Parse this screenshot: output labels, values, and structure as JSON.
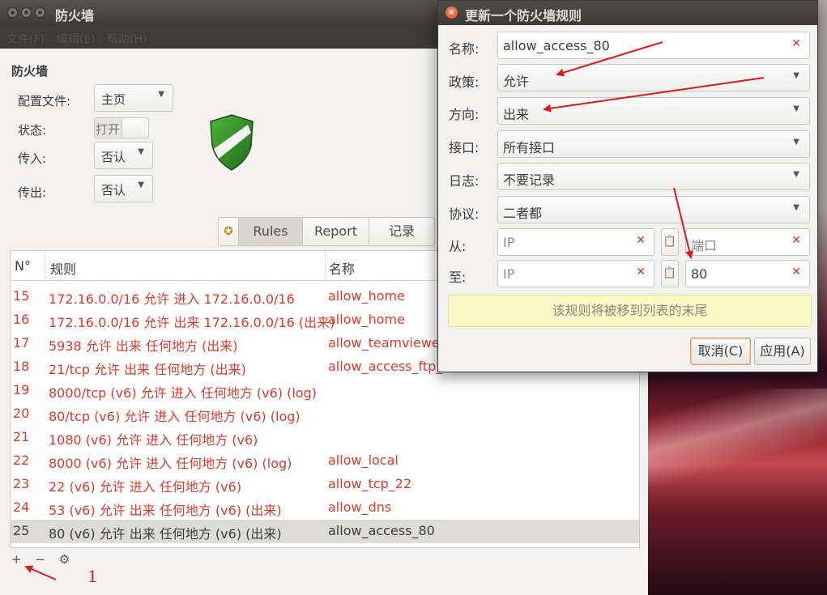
{
  "main_window": {
    "title": "防火墙",
    "menu": [
      "文件(F)",
      "编辑(E)",
      "帮助(H)"
    ],
    "section_title": "防火墙",
    "profile_label": "配置文件:",
    "profile_value": "主页",
    "status_label": "状态:",
    "status_value": "打开",
    "incoming_label": "传入:",
    "incoming_value": "否认",
    "outgoing_label": "传出:",
    "outgoing_value": "否认",
    "tabs": [
      "Rules",
      "Report",
      "记录"
    ],
    "table": {
      "headers": [
        "N°",
        "规则",
        "名称"
      ],
      "rows": [
        {
          "no": "15",
          "rule": "172.16.0.0/16 允许 进入 172.16.0.0/16",
          "name": "allow_home"
        },
        {
          "no": "16",
          "rule": "172.16.0.0/16 允许 出来 172.16.0.0/16 (出来)",
          "name": "allow_home"
        },
        {
          "no": "17",
          "rule": "5938 允许 出来 任何地方 (出来)",
          "name": "allow_teamviewer"
        },
        {
          "no": "18",
          "rule": "21/tcp 允许 出来 任何地方 (出来)",
          "name": "allow_access_ftp_"
        },
        {
          "no": "19",
          "rule": "8000/tcp (v6) 允许 进入 任何地方 (v6) (log)",
          "name": ""
        },
        {
          "no": "20",
          "rule": "80/tcp (v6) 允许 进入 任何地方 (v6) (log)",
          "name": ""
        },
        {
          "no": "21",
          "rule": "1080 (v6) 允许 进入 任何地方 (v6)",
          "name": ""
        },
        {
          "no": "22",
          "rule": "8000 (v6) 允许 进入 任何地方 (v6) (log)",
          "name": "allow_local"
        },
        {
          "no": "23",
          "rule": "22 (v6) 允许 进入 任何地方 (v6)",
          "name": "allow_tcp_22"
        },
        {
          "no": "24",
          "rule": "53 (v6) 允许 出来 任何地方 (v6) (出来)",
          "name": "allow_dns"
        },
        {
          "no": "25",
          "rule": "80 (v6) 允许 出来 任何地方 (v6) (出来)",
          "name": "allow_access_80"
        }
      ]
    },
    "bottom_tools": [
      "+",
      "−",
      "⚙"
    ],
    "annotation_number": "1"
  },
  "dialog": {
    "title": "更新一个防火墙规则",
    "name_label": "名称:",
    "name_value": "allow_access_80",
    "policy_label": "政策:",
    "policy_value": "允许",
    "direction_label": "方向:",
    "direction_value": "出来",
    "interface_label": "接口:",
    "interface_value": "所有接口",
    "log_label": "日志:",
    "log_value": "不要记录",
    "protocol_label": "协议:",
    "protocol_value": "二者都",
    "from_label": "从:",
    "from_ip_placeholder": "IP",
    "from_port_placeholder": "端口",
    "to_label": "至:",
    "to_ip_placeholder": "IP",
    "to_port_value": "80",
    "info_text": "该规则将被移到列表的末尾",
    "cancel_label": "取消(C)",
    "apply_label": "应用(A)"
  },
  "colors": {
    "rule_text": "#df382c",
    "selected_row": "#dedcd9",
    "annotation": "#d42020",
    "info_bar": "#fbf8c5"
  },
  "icons": [
    "close-icon",
    "dropdown-arrow-icon",
    "clear-field-icon",
    "paste-icon",
    "shield-icon",
    "settings-gear-icon"
  ]
}
